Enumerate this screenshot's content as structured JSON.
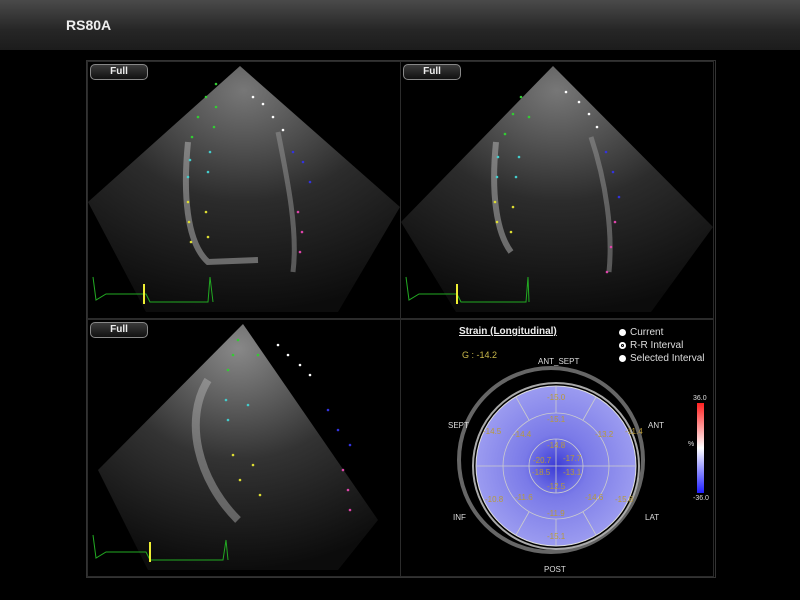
{
  "app": {
    "title": "RS80A"
  },
  "views": [
    {
      "button": "Full"
    },
    {
      "button": "Full"
    },
    {
      "button": "Full"
    }
  ],
  "strain": {
    "title": "Strain (Longitudinal)",
    "global": "G : -14.2",
    "legend": [
      "Current",
      "R-R Interval",
      "Selected Interval"
    ],
    "directions": {
      "ant_sept": "ANT_SEPT",
      "sept": "SEPT",
      "ant": "ANT",
      "inf": "INF",
      "lat": "LAT",
      "post": "POST"
    },
    "segments": [
      "-15.0",
      "-15.1",
      "-14.5",
      "-14.4",
      "-14.8",
      "-13.2",
      "-11.4",
      "-20.7",
      "-17.7",
      "-18.5",
      "-13.1",
      "-12.5",
      "-10.8",
      "-11.6",
      "-14.6",
      "-15.8",
      "-11.9",
      "-15.1"
    ],
    "scale": {
      "max": "36.0",
      "min": "-36.0",
      "unit": "%"
    },
    "colors": {
      "bullseye": "#6f6fe6",
      "center": "#3b3bd6",
      "segment_text": "#b89a3a"
    }
  }
}
